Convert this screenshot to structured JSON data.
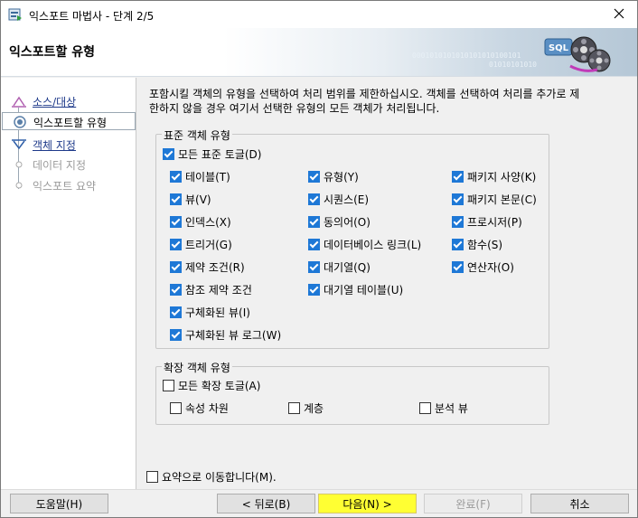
{
  "window": {
    "title": "익스포트 마법사 - 단계 2/5",
    "icons": {
      "app": "wizard-app-icon",
      "close": "close-icon"
    }
  },
  "banner": {
    "title": "익스포트할 유형",
    "art_text": "SQL",
    "binary_text": "0001010101010101010100101",
    "binary_text2": "01010101010"
  },
  "steps": [
    {
      "label": "소스/대상",
      "state": "link"
    },
    {
      "label": "익스포트할 유형",
      "state": "current"
    },
    {
      "label": "객체 지정",
      "state": "link"
    },
    {
      "label": "데이터 지정",
      "state": "disabled"
    },
    {
      "label": "익스포트 요약",
      "state": "disabled"
    }
  ],
  "description_line1": "포함시킬 객체의 유형을 선택하여 처리 범위를 제한하십시오. 객체를 선택하여 처리를 추가로 제",
  "description_line2": "한하지 않을 경우 여기서 선택한 유형의 모든 객체가 처리됩니다.",
  "standard": {
    "legend": "표준 객체 유형",
    "all_toggle": {
      "label": "모든 표준 토글(D)",
      "checked": true
    },
    "items": [
      {
        "label": "테이블(T)",
        "checked": true
      },
      {
        "label": "뷰(V)",
        "checked": true
      },
      {
        "label": "인덱스(X)",
        "checked": true
      },
      {
        "label": "트리거(G)",
        "checked": true
      },
      {
        "label": "제약 조건(R)",
        "checked": true
      },
      {
        "label": "참조 제약 조건",
        "checked": true
      },
      {
        "label": "구체화된 뷰(I)",
        "checked": true
      },
      {
        "label": "구체화된 뷰 로그(W)",
        "checked": true
      },
      {
        "label": "유형(Y)",
        "checked": true
      },
      {
        "label": "시퀀스(E)",
        "checked": true
      },
      {
        "label": "동의어(O)",
        "checked": true
      },
      {
        "label": "데이터베이스 링크(L)",
        "checked": true
      },
      {
        "label": "대기열(Q)",
        "checked": true
      },
      {
        "label": "대기열 테이블(U)",
        "checked": true
      },
      {
        "label": "패키지 사양(K)",
        "checked": true
      },
      {
        "label": "패키지 본문(C)",
        "checked": true
      },
      {
        "label": "프로시저(P)",
        "checked": true
      },
      {
        "label": "함수(S)",
        "checked": true
      },
      {
        "label": "연산자(O)",
        "checked": true
      }
    ]
  },
  "extended": {
    "legend": "확장 객체 유형",
    "all_toggle": {
      "label": "모든 확장 토글(A)",
      "checked": false
    },
    "items": [
      {
        "label": "속성 차원",
        "checked": false
      },
      {
        "label": "계층",
        "checked": false
      },
      {
        "label": "분석 뷰",
        "checked": false
      }
    ]
  },
  "skip_to_summary": {
    "label": "요약으로 이동합니다(M).",
    "checked": false
  },
  "buttons": {
    "help": "도움말(H)",
    "back": "< 뒤로(B)",
    "next": "다음(N) >",
    "finish": "완료(F)",
    "cancel": "취소"
  },
  "colors": {
    "checkbox_checked": "#1e78d6",
    "next_highlight": "#ffff33",
    "nav_link": "#1e3a8a"
  }
}
